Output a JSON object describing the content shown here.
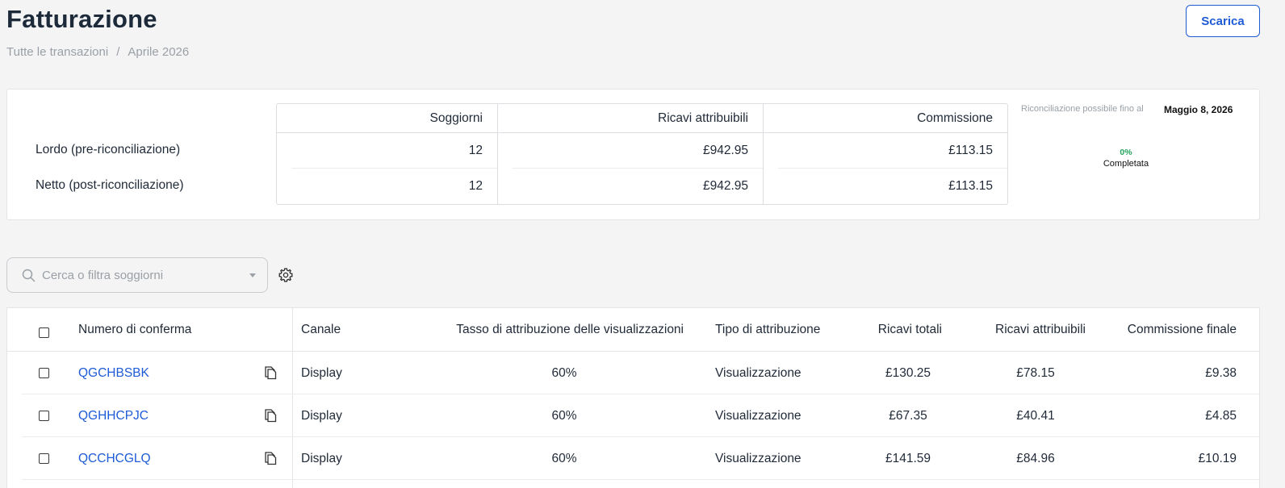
{
  "header": {
    "title": "Fatturazione",
    "breadcrumb": [
      "Tutte le transazioni",
      "/",
      "Aprile 2026"
    ],
    "download_label": "Scarica"
  },
  "summary": {
    "columns": [
      "Soggiorni",
      "Ricavi attribuibili",
      "Commissione"
    ],
    "rows": [
      {
        "label": "Lordo (pre-riconciliazione)",
        "values": [
          "12",
          "£942.95",
          "£113.15"
        ]
      },
      {
        "label": "Netto (post-riconciliazione)",
        "values": [
          "12",
          "£942.95",
          "£113.15"
        ]
      }
    ],
    "reconciliation_label": "Riconciliazione possibile fino al",
    "reconciliation_date": "Maggio 8, 2026",
    "progress_percent": "0%",
    "progress_label": "Completata",
    "progress_color": "#22a35a"
  },
  "filter": {
    "search_placeholder": "Cerca o filtra soggiorni",
    "settings_icon": "gear-icon"
  },
  "table": {
    "columns": [
      "Numero di conferma",
      "Canale",
      "Tasso di attribuzione delle visualizzazioni",
      "Tipo di attribuzione",
      "Ricavi totali",
      "Ricavi attribuibili",
      "Commissione finale"
    ],
    "rows": [
      {
        "confirmation": "QGCHBSBK",
        "channel": "Display",
        "rate": "60%",
        "type": "Visualizzazione",
        "total": "£130.25",
        "attributable": "£78.15",
        "commission": "£9.38"
      },
      {
        "confirmation": "QGHHCPJC",
        "channel": "Display",
        "rate": "60%",
        "type": "Visualizzazione",
        "total": "£67.35",
        "attributable": "£40.41",
        "commission": "£4.85"
      },
      {
        "confirmation": "QCCHCGLQ",
        "channel": "Display",
        "rate": "60%",
        "type": "Visualizzazione",
        "total": "£141.59",
        "attributable": "£84.96",
        "commission": "£10.19"
      }
    ]
  },
  "colors": {
    "accent": "#1e5bd6",
    "title": "#1c2a3a"
  }
}
